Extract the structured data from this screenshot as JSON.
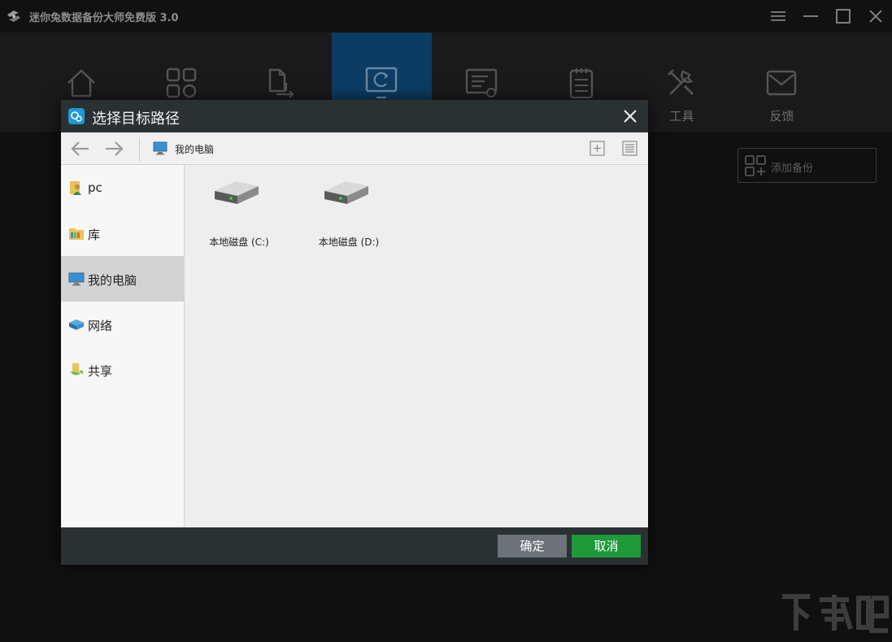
{
  "app": {
    "title": "迷你兔数据备份大师免费版 3.0"
  },
  "nav": {
    "items": [
      {
        "label": "",
        "icon": "home-icon"
      },
      {
        "label": "",
        "icon": "apps-icon"
      },
      {
        "label": "",
        "icon": "file-transfer-icon"
      },
      {
        "label": "",
        "icon": "backup-icon"
      },
      {
        "label": "",
        "icon": "task-list-icon"
      },
      {
        "label": "",
        "icon": "clipboard-icon"
      },
      {
        "label": "工具",
        "icon": "tools-icon"
      },
      {
        "label": "反馈",
        "icon": "mail-icon"
      }
    ],
    "active_index": 3
  },
  "content": {
    "add_backup_label": "添加备份"
  },
  "dialog": {
    "title": "选择目标路径",
    "path": "我的电脑",
    "sidebar": [
      {
        "label": "pc",
        "icon": "user-folder-icon"
      },
      {
        "label": "库",
        "icon": "library-icon"
      },
      {
        "label": "我的电脑",
        "icon": "computer-icon"
      },
      {
        "label": "网络",
        "icon": "network-icon"
      },
      {
        "label": "共享",
        "icon": "share-icon"
      }
    ],
    "selected_sidebar_index": 2,
    "drives": [
      {
        "label": "本地磁盘 (C:)"
      },
      {
        "label": "本地磁盘 (D:)"
      }
    ],
    "ok_label": "确定",
    "cancel_label": "取消"
  },
  "colors": {
    "accent_active": "#0c3c63",
    "ok_button": "#6c7277",
    "cancel_button": "#1f9a3a"
  }
}
